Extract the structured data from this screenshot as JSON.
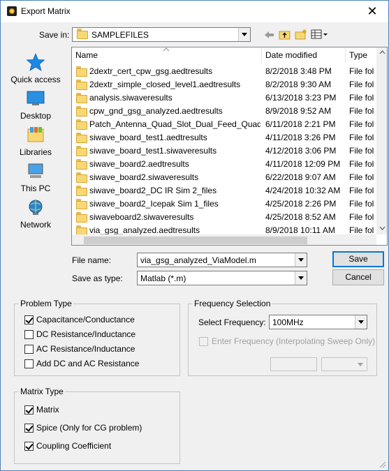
{
  "window": {
    "title": "Export Matrix",
    "close_glyph": "✕"
  },
  "save_in": {
    "label": "Save in:",
    "value": "SAMPLEFILES"
  },
  "places": [
    {
      "label": "Quick access",
      "icon": "star-icon"
    },
    {
      "label": "Desktop",
      "icon": "desktop-icon"
    },
    {
      "label": "Libraries",
      "icon": "libraries-icon"
    },
    {
      "label": "This PC",
      "icon": "computer-icon"
    },
    {
      "label": "Network",
      "icon": "network-icon"
    }
  ],
  "file_list": {
    "columns": [
      "Name",
      "Date modified",
      "Type"
    ],
    "rows": [
      {
        "name": "2dextr_cert_cpw_gsg.aedtresults",
        "date": "8/2/2018 3:48 PM",
        "type": "File fol"
      },
      {
        "name": "2dextr_simple_closed_level1.aedtresults",
        "date": "8/2/2018 9:30 AM",
        "type": "File fol"
      },
      {
        "name": "analysis.siwaveresults",
        "date": "6/13/2018 3:23 PM",
        "type": "File fol"
      },
      {
        "name": "cpw_gnd_gsg_analyzed.aedtresults",
        "date": "8/9/2018 9:52 AM",
        "type": "File fol"
      },
      {
        "name": "Patch_Antenna_Quad_Slot_Dual_Feed_Quad...",
        "date": "6/11/2018 2:21 PM",
        "type": "File fol"
      },
      {
        "name": "siwave_board_test1.aedtresults",
        "date": "4/11/2018 3:26 PM",
        "type": "File fol"
      },
      {
        "name": "siwave_board_test1.siwaveresults",
        "date": "4/12/2018 3:06 PM",
        "type": "File fol"
      },
      {
        "name": "siwave_board2.aedtresults",
        "date": "4/11/2018 12:09 PM",
        "type": "File fol"
      },
      {
        "name": "siwave_board2.siwaveresults",
        "date": "6/22/2018 9:07 AM",
        "type": "File fol"
      },
      {
        "name": "siwave_board2_DC IR Sim 2_files",
        "date": "4/24/2018 10:32 AM",
        "type": "File fol"
      },
      {
        "name": "siwave_board2_Icepak Sim 1_files",
        "date": "4/25/2018 2:26 PM",
        "type": "File fol"
      },
      {
        "name": "siwaveboard2.siwaveresults",
        "date": "4/25/2018 8:52 AM",
        "type": "File fol"
      },
      {
        "name": "via_gsg_analyzed.aedtresults",
        "date": "8/9/2018 10:11 AM",
        "type": "File fol"
      }
    ]
  },
  "file_name": {
    "label": "File name:",
    "value": "via_gsg_analyzed_ViaModel.m"
  },
  "save_as_type": {
    "label": "Save as type:",
    "value": "Matlab (*.m)"
  },
  "buttons": {
    "save": "Save",
    "cancel": "Cancel"
  },
  "problem_type": {
    "title": "Problem Type",
    "options": [
      {
        "label": "Capacitance/Conductance",
        "checked": true
      },
      {
        "label": "DC Resistance/Inductance",
        "checked": false
      },
      {
        "label": "AC Resistance/Inductance",
        "checked": false
      },
      {
        "label": "Add DC and AC Resistance",
        "checked": false
      }
    ]
  },
  "frequency_selection": {
    "title": "Frequency Selection",
    "select_label": "Select Frequency:",
    "select_value": "100MHz",
    "enter_label": "Enter Frequency (Interpolating Sweep Only)"
  },
  "matrix_type": {
    "title": "Matrix Type",
    "options": [
      {
        "label": "Matrix",
        "checked": true
      },
      {
        "label": "Spice (Only for CG problem)",
        "checked": true
      },
      {
        "label": "Coupling Coefficient",
        "checked": true
      }
    ]
  },
  "colors": {
    "accent": "#0078d7",
    "folder": "#f8d775"
  }
}
